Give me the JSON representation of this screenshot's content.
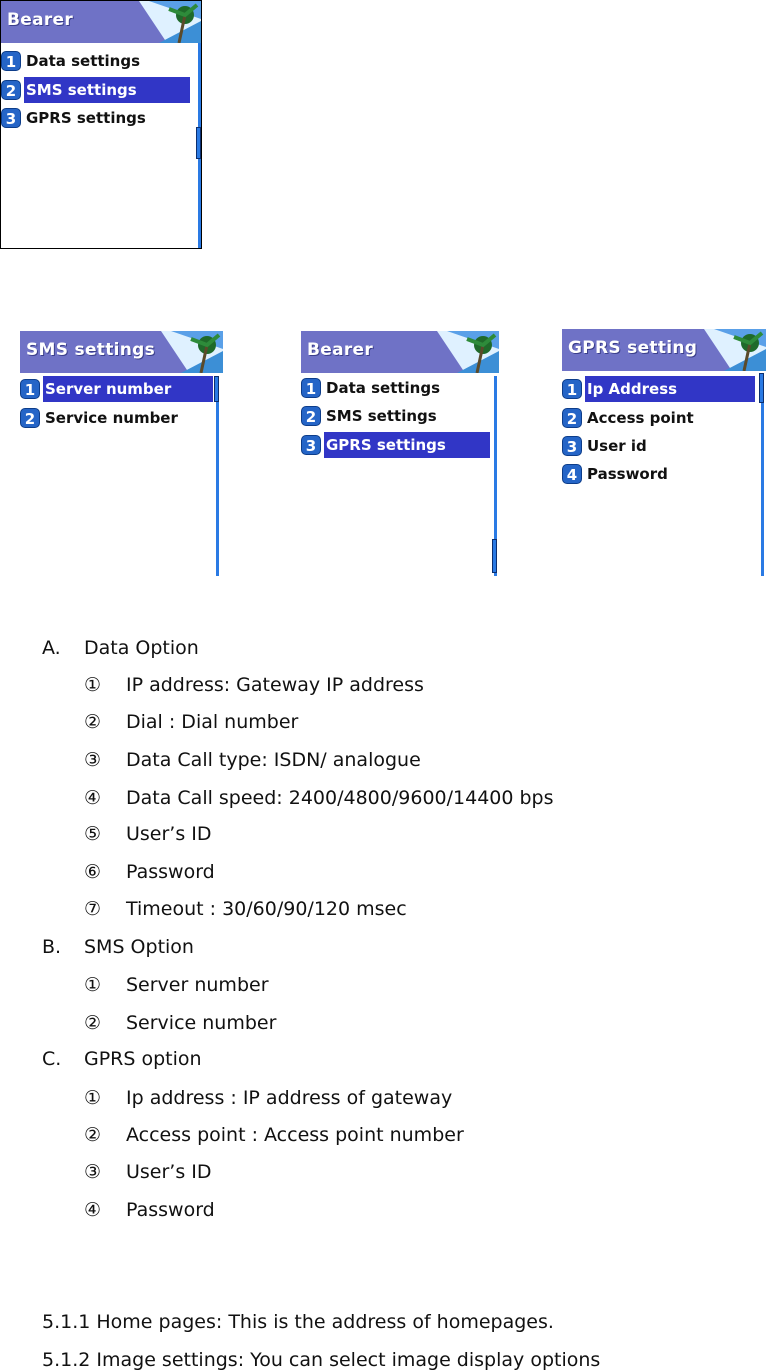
{
  "screens": [
    {
      "title": "Bearer",
      "items": [
        {
          "num": "1",
          "label": "Data settings",
          "selected": false
        },
        {
          "num": "2",
          "label": "SMS settings",
          "selected": true
        },
        {
          "num": "3",
          "label": "GPRS settings",
          "selected": false
        }
      ]
    },
    {
      "title": "SMS settings",
      "items": [
        {
          "num": "1",
          "label": "Server number",
          "selected": true
        },
        {
          "num": "2",
          "label": "Service number",
          "selected": false
        }
      ]
    },
    {
      "title": "Bearer",
      "items": [
        {
          "num": "1",
          "label": "Data settings",
          "selected": false
        },
        {
          "num": "2",
          "label": "SMS settings",
          "selected": false
        },
        {
          "num": "3",
          "label": "GPRS settings",
          "selected": true
        }
      ]
    },
    {
      "title": "GPRS setting",
      "items": [
        {
          "num": "1",
          "label": "Ip Address",
          "selected": true
        },
        {
          "num": "2",
          "label": "Access point",
          "selected": false
        },
        {
          "num": "3",
          "label": "User id",
          "selected": false
        },
        {
          "num": "4",
          "label": "Password",
          "selected": false
        }
      ]
    }
  ],
  "doc": {
    "sections": [
      {
        "marker": "A.",
        "heading": "Data Option",
        "items": [
          {
            "marker": "①",
            "text": "IP address: Gateway IP address"
          },
          {
            "marker": "②",
            "text": "Dial : Dial number"
          },
          {
            "marker": "③",
            "text": "Data Call type: ISDN/ analogue"
          },
          {
            "marker": "④",
            "text": "Data Call speed: 2400/4800/9600/14400 bps"
          },
          {
            "marker": "⑤",
            "text": "User’s ID"
          },
          {
            "marker": "⑥",
            "text": "Password"
          },
          {
            "marker": "⑦",
            "text": "Timeout : 30/60/90/120 msec"
          }
        ]
      },
      {
        "marker": "B.",
        "heading": "SMS Option",
        "items": [
          {
            "marker": "①",
            "text": "Server number"
          },
          {
            "marker": "②",
            "text": "Service number"
          }
        ]
      },
      {
        "marker": "C.",
        "heading": "GPRS option",
        "items": [
          {
            "marker": "①",
            "text": "Ip address : IP address of gateway"
          },
          {
            "marker": "②",
            "text": "Access point : Access point number"
          },
          {
            "marker": "③",
            "text": "User’s ID"
          },
          {
            "marker": "④",
            "text": "Password"
          }
        ]
      }
    ],
    "footer_lines": [
      "5.1.1 Home pages: This is the address of homepages.",
      "5.1.2 Image settings: You can select image display options"
    ]
  }
}
